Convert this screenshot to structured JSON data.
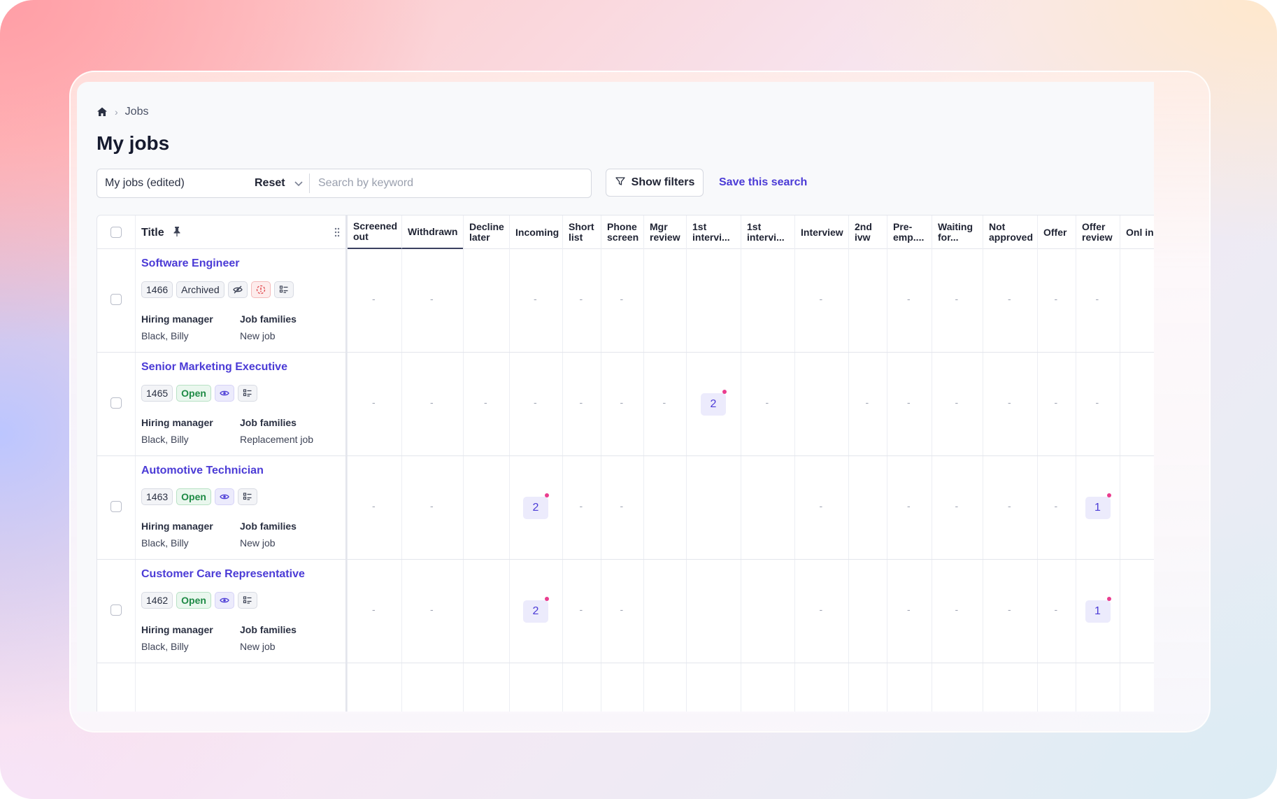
{
  "breadcrumb": {
    "section": "Jobs"
  },
  "page_title": "My jobs",
  "search": {
    "saved_search": "My jobs (edited)",
    "reset_label": "Reset",
    "placeholder": "Search by keyword"
  },
  "filters_label": "Show filters",
  "save_search_label": "Save this search",
  "table": {
    "title_header": "Title",
    "columns": [
      "Screened out",
      "Withdrawn",
      "Decline later",
      "Incoming",
      "Short list",
      "Phone screen",
      "Mgr review",
      "1st intervi...",
      "1st intervi...",
      "Interview",
      "2nd ivw",
      "Pre-emp....",
      "Waiting for...",
      "Not approved",
      "Offer",
      "Offer review",
      "Onl in p"
    ],
    "meta_labels": {
      "manager": "Hiring manager",
      "families": "Job families"
    },
    "rows": [
      {
        "title": "Software Engineer",
        "id": "1466",
        "status": "Archived",
        "manager": "Black, Billy",
        "family": "New job",
        "cells": [
          "-",
          "-",
          "",
          "-",
          "-",
          "-",
          "",
          "",
          "",
          "-",
          "",
          "-",
          "-",
          "-",
          "-",
          "-",
          ""
        ]
      },
      {
        "title": "Senior Marketing Executive",
        "id": "1465",
        "status": "Open",
        "manager": "Black, Billy",
        "family": "Replacement job",
        "cells": [
          "-",
          "-",
          "-",
          "-",
          "-",
          "-",
          "-",
          "2",
          "-",
          "",
          "-",
          "-",
          "-",
          "-",
          "-",
          "-",
          ""
        ]
      },
      {
        "title": "Automotive Technician",
        "id": "1463",
        "status": "Open",
        "manager": "Black, Billy",
        "family": "New job",
        "cells": [
          "-",
          "-",
          "",
          "2",
          "-",
          "-",
          "",
          "",
          "",
          "-",
          "",
          "-",
          "-",
          "-",
          "-",
          "1",
          ""
        ]
      },
      {
        "title": "Customer Care Representative",
        "id": "1462",
        "status": "Open",
        "manager": "Black, Billy",
        "family": "New job",
        "cells": [
          "-",
          "-",
          "",
          "2",
          "-",
          "-",
          "",
          "",
          "",
          "-",
          "",
          "-",
          "-",
          "-",
          "-",
          "1",
          ""
        ]
      }
    ]
  },
  "colors": {
    "accent": "#4b3bd6",
    "open_green": "#1e8a45",
    "dot_pink": "#ea3d8f"
  }
}
